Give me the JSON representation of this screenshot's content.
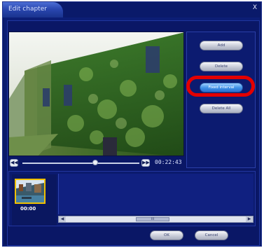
{
  "window": {
    "title": "Edit chapter",
    "close_glyph": "X"
  },
  "player": {
    "timecode": "00:22:43",
    "prev_glyph": "◀◀",
    "next_glyph": "▶▶",
    "position_fraction": 0.62
  },
  "actions": {
    "add_label": "Add",
    "delete_label": "Delete",
    "fixed_interval_label": "Fixed interval",
    "delete_all_label": "Delete All"
  },
  "chapters": [
    {
      "time": "00:00"
    }
  ],
  "scrollbar": {
    "left_glyph": "◀",
    "right_glyph": "▶",
    "grip_glyph": "III"
  },
  "footer": {
    "ok_label": "OK",
    "cancel_label": "Cancel"
  },
  "colors": {
    "highlight_ring": "#e40000",
    "active_button": "#3d8fe6",
    "window_bg": "#0c1f78"
  },
  "icons": {
    "prev": "skip-back-icon",
    "next": "skip-forward-icon",
    "close": "close-icon"
  }
}
